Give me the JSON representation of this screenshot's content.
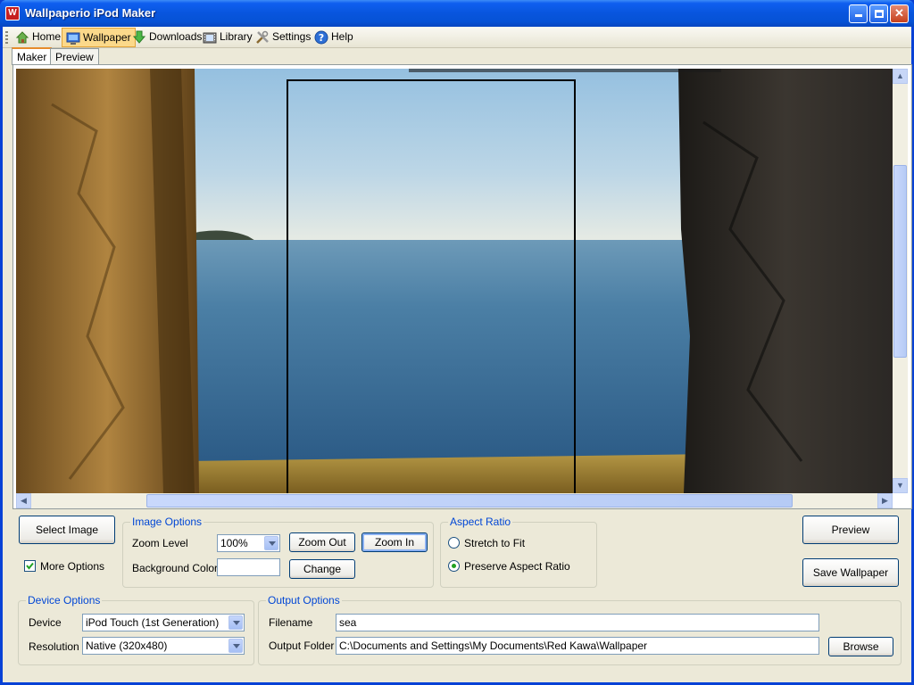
{
  "window": {
    "title": "Wallpaperio iPod Maker",
    "app_icon_text": "W"
  },
  "toolbar": {
    "items": [
      {
        "label": "Home",
        "icon": "home-icon"
      },
      {
        "label": "Wallpaper",
        "icon": "monitor-icon",
        "active": true
      },
      {
        "label": "Downloads",
        "icon": "download-arrow-icon"
      },
      {
        "label": "Library",
        "icon": "film-library-icon"
      },
      {
        "label": "Settings",
        "icon": "tools-icon"
      },
      {
        "label": "Help",
        "icon": "help-icon"
      }
    ]
  },
  "tabs": [
    {
      "label": "Maker",
      "active": true
    },
    {
      "label": "Preview"
    }
  ],
  "image_options": {
    "title": "Image Options",
    "zoom_label": "Zoom Level",
    "zoom_value": "100%",
    "bg_color_label": "Background Color",
    "bg_color_value": "#ffffff",
    "zoom_out_label": "Zoom Out",
    "zoom_in_label": "Zoom In",
    "change_label": "Change"
  },
  "actions": {
    "select_image_label": "Select Image",
    "more_options_label": "More Options",
    "more_options_checked": true,
    "preview_label": "Preview",
    "save_wallpaper_label": "Save Wallpaper"
  },
  "aspect_ratio": {
    "title": "Aspect Ratio",
    "options": [
      {
        "label": "Stretch to Fit",
        "checked": false
      },
      {
        "label": "Preserve Aspect Ratio",
        "checked": true
      }
    ]
  },
  "device_options": {
    "title": "Device Options",
    "device_label": "Device",
    "device_value": "iPod Touch (1st Generation)",
    "resolution_label": "Resolution",
    "resolution_value": "Native (320x480)"
  },
  "output_options": {
    "title": "Output Options",
    "filename_label": "Filename",
    "filename_value": "sea",
    "folder_label": "Output Folder",
    "folder_value": "C:\\Documents and Settings\\My Documents\\Red Kawa\\Wallpaper",
    "browse_label": "Browse"
  },
  "colors": {
    "titlebar": "#0855dd",
    "accent": "#0046d5",
    "active_tool": "#fbd98a"
  }
}
